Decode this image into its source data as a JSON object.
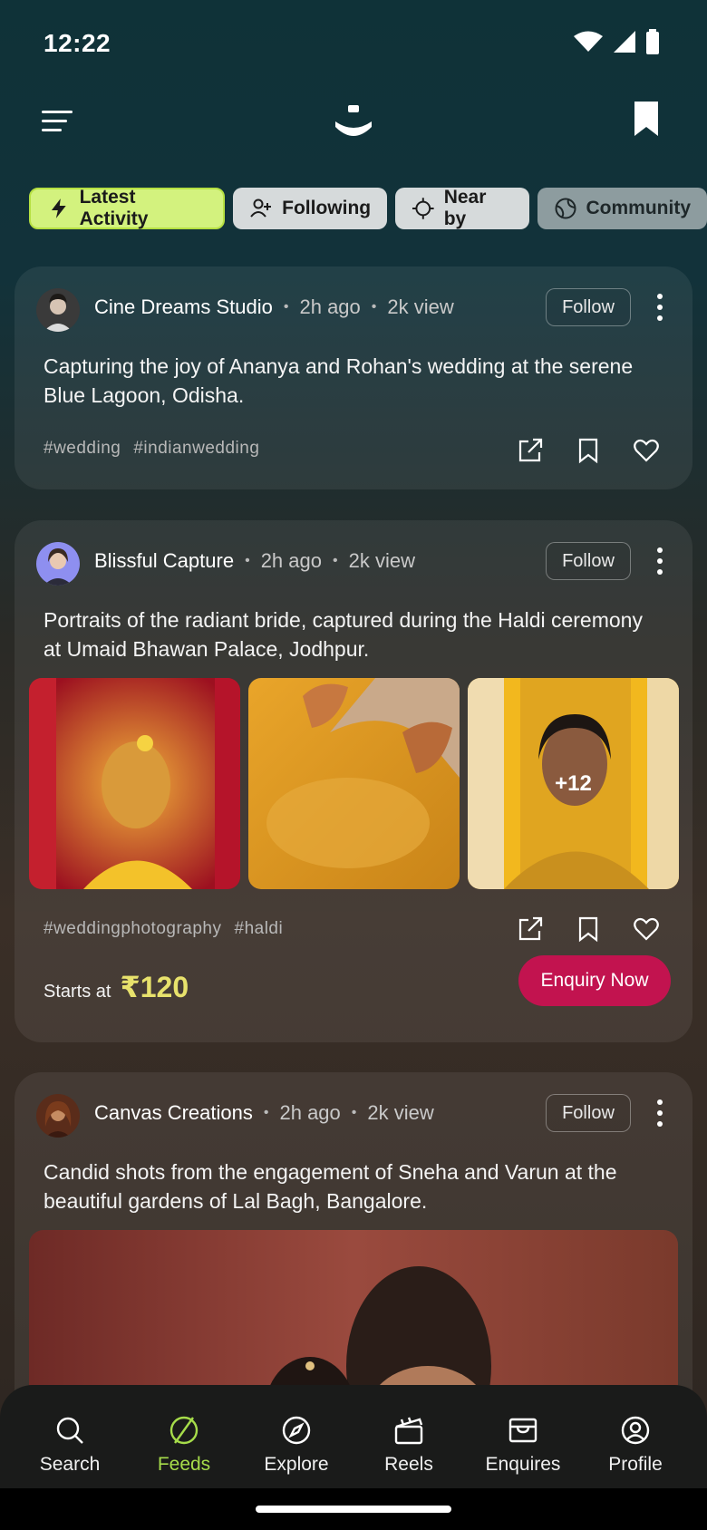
{
  "status": {
    "time": "12:22"
  },
  "filters": [
    {
      "label": "Latest Activity",
      "icon": "lightning-icon"
    },
    {
      "label": "Following",
      "icon": "user-plus-icon"
    },
    {
      "label": "Near by",
      "icon": "crosshair-icon"
    },
    {
      "label": "Community",
      "icon": "globe-icon"
    }
  ],
  "posts": [
    {
      "author": "Cine Dreams Studio",
      "time": "2h ago",
      "views": "2k view",
      "follow_label": "Follow",
      "caption": "Capturing the joy of Ananya and Rohan's wedding at the serene Blue Lagoon, Odisha.",
      "tags": [
        "#wedding",
        "#indianwedding"
      ]
    },
    {
      "author": "Blissful Capture",
      "time": "2h ago",
      "views": "2k view",
      "follow_label": "Follow",
      "caption": "Portraits of the radiant bride, captured during the Haldi ceremony at Umaid Bhawan Palace, Jodhpur.",
      "more_photos": "+12",
      "tags": [
        "#weddingphotography",
        "#haldi"
      ],
      "price_label": "Starts at",
      "price": "₹120",
      "enquiry_label": "Enquiry Now"
    },
    {
      "author": "Canvas Creations",
      "time": "2h ago",
      "views": "2k view",
      "follow_label": "Follow",
      "caption": "Candid shots from the engagement of Sneha and Varun at the beautiful gardens of Lal Bagh, Bangalore."
    }
  ],
  "nav": [
    {
      "label": "Search",
      "icon": "search-icon"
    },
    {
      "label": "Feeds",
      "icon": "feeds-icon"
    },
    {
      "label": "Explore",
      "icon": "compass-icon"
    },
    {
      "label": "Reels",
      "icon": "clapper-icon"
    },
    {
      "label": "Enquires",
      "icon": "inbox-icon"
    },
    {
      "label": "Profile",
      "icon": "profile-icon"
    }
  ],
  "colors": {
    "accent": "#a6dc4a",
    "chip_active": "#d3f27e",
    "price": "#e8e26c",
    "enquiry_button": "#c2134f"
  }
}
